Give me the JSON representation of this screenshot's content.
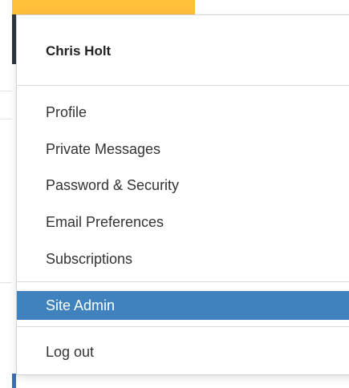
{
  "user_menu": {
    "user_name": "Chris Holt",
    "items": [
      {
        "label": "Profile"
      },
      {
        "label": "Private Messages"
      },
      {
        "label": "Password & Security"
      },
      {
        "label": "Email Preferences"
      },
      {
        "label": "Subscriptions"
      }
    ],
    "admin_item": {
      "label": "Site Admin",
      "highlighted": true
    },
    "logout_item": {
      "label": "Log out"
    }
  },
  "colors": {
    "accent_bar": "#ffc13a",
    "highlight": "#3f82bd",
    "text": "#333333"
  }
}
